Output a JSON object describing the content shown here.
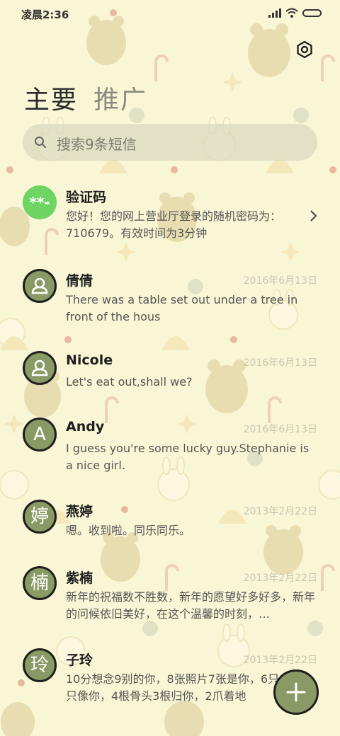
{
  "status_bar": {
    "time": "凌晨2:36"
  },
  "tabs": [
    {
      "label": "主要",
      "active": true
    },
    {
      "label": "推广",
      "active": false
    }
  ],
  "search": {
    "placeholder": "搜索9条短信"
  },
  "conversations": [
    {
      "name": "验证码",
      "avatar_text": "**-",
      "date": "",
      "preview": "您好！您的网上营业厅登录的随机密码为：710679。有效时间为3分钟"
    },
    {
      "name": "倩倩",
      "avatar_text": "",
      "date": "2016年6月13日",
      "preview": "There was a table set out under a tree in front of the hous"
    },
    {
      "name": "Nicole",
      "avatar_text": "",
      "date": "2016年6月13日",
      "preview": "Let's eat out,shall we?"
    },
    {
      "name": "Andy",
      "avatar_text": "A",
      "date": "2016年6月13日",
      "preview": "I guess you're some lucky guy.Stephanie is a nice girl."
    },
    {
      "name": "燕婷",
      "avatar_text": "婷",
      "date": "2013年2月22日",
      "preview": "嗯。收到啦。同乐同乐。"
    },
    {
      "name": "紫楠",
      "avatar_text": "楠",
      "date": "2013年2月22日",
      "preview": "新年的祝福数不胜数，新年的愿望好多好多，新年的问候依旧美好，在这个温馨的时刻，…"
    },
    {
      "name": "子玲",
      "avatar_text": "玲",
      "date": "2013年2月22日",
      "preview": "10分想念9别的你，8张照片7张是你，6只小狗5只像你，4根骨头3根归你，2爪着地"
    }
  ],
  "colors": {
    "background": "#f9f6d6",
    "avatar": "#8a9a64",
    "verify_avatar": "#6ed562"
  }
}
